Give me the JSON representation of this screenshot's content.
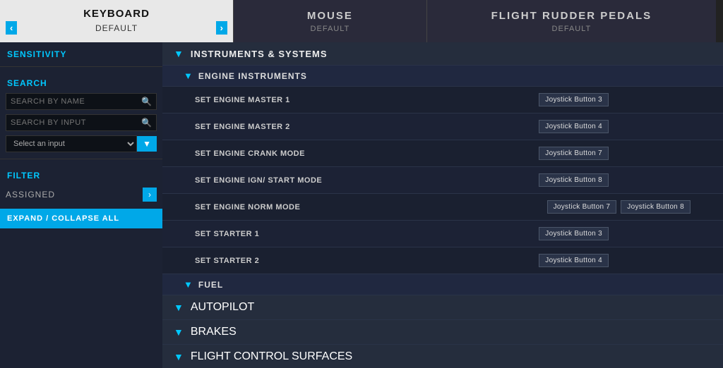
{
  "tabs": {
    "keyboard": {
      "title": "KEYBOARD",
      "subtitle": "DEFAULT",
      "arrow_left": "‹",
      "arrow_right": "›"
    },
    "mouse": {
      "title": "MOUSE",
      "subtitle": "DEFAULT"
    },
    "rudder": {
      "title": "FLIGHT RUDDER PEDALS",
      "subtitle": "DEFAULT"
    }
  },
  "sidebar": {
    "sensitivity_label": "SENSITIVITY",
    "search_label": "SEARCH",
    "search_by_name_placeholder": "SEARCH BY NAME",
    "search_by_input_placeholder": "SEARCH BY INPUT",
    "select_placeholder": "Select an input",
    "filter_label": "FILTER",
    "assigned_label": "ASSIGNED",
    "expand_collapse_label": "EXPAND / COLLAPSE ALL"
  },
  "sections": [
    {
      "id": "instruments-systems",
      "title": "INSTRUMENTS & SYSTEMS",
      "expanded": true,
      "subsections": [
        {
          "id": "engine-instruments",
          "title": "ENGINE INSTRUMENTS",
          "expanded": true,
          "bindings": [
            {
              "name": "SET ENGINE MASTER 1",
              "primary": "Joystick Button 3",
              "secondary": ""
            },
            {
              "name": "SET ENGINE MASTER 2",
              "primary": "Joystick Button 4",
              "secondary": ""
            },
            {
              "name": "SET ENGINE CRANK MODE",
              "primary": "Joystick Button 7",
              "secondary": ""
            },
            {
              "name": "SET ENGINE IGN/ START MODE",
              "primary": "Joystick Button 8",
              "secondary": ""
            },
            {
              "name": "SET ENGINE NORM MODE",
              "primary": "Joystick Button 7",
              "secondary": "Joystick Button 8"
            },
            {
              "name": "SET STARTER 1",
              "primary": "Joystick Button 3",
              "secondary": ""
            },
            {
              "name": "SET STARTER 2",
              "primary": "Joystick Button 4",
              "secondary": ""
            }
          ]
        },
        {
          "id": "fuel",
          "title": "FUEL",
          "expanded": false,
          "bindings": []
        }
      ]
    },
    {
      "id": "autopilot",
      "title": "AUTOPILOT",
      "expanded": false,
      "subsections": []
    },
    {
      "id": "brakes",
      "title": "BRAKES",
      "expanded": false,
      "subsections": []
    },
    {
      "id": "flight-control-surfaces",
      "title": "FLIGHT CONTROL SURFACES",
      "expanded": false,
      "subsections": []
    }
  ],
  "icons": {
    "chevron_down": "▼",
    "chevron_up": "▲",
    "chevron_right": "›",
    "search": "🔍"
  }
}
